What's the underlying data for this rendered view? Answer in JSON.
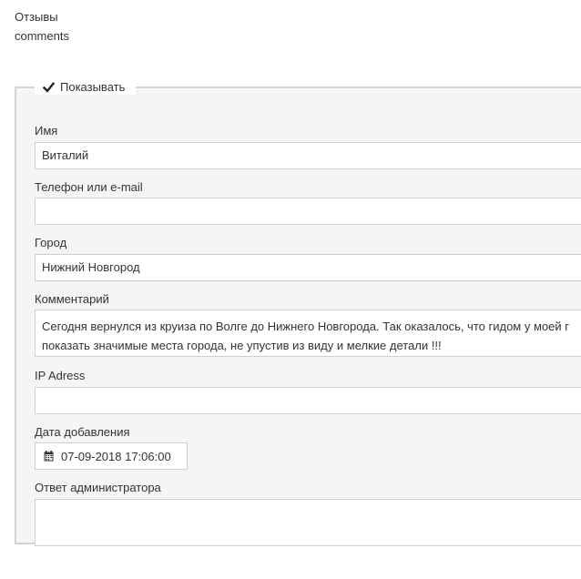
{
  "header": {
    "title_ru": "Отзывы",
    "title_en": "comments"
  },
  "record": {
    "show_label": "Показывать",
    "show_checked": true,
    "fields": {
      "name": {
        "label": "Имя",
        "value": "Виталий"
      },
      "contact": {
        "label": "Телефон или e-mail",
        "value": ""
      },
      "city": {
        "label": "Город",
        "value": "Нижний Новгород"
      },
      "comment": {
        "label": "Комментарий",
        "line1": "Сегодня вернулся из круиза по Волге до Нижнего Новгорода. Так оказалось, что гидом у моей г",
        "line2": "показать значимые места города, не упустив из виду и мелкие детали !!!"
      },
      "ip": {
        "label": "IP Adress",
        "value": ""
      },
      "date": {
        "label": "Дата добавления",
        "value": "07-09-2018 17:06:00"
      },
      "admin_reply": {
        "label": "Ответ администратора",
        "value": ""
      }
    }
  },
  "icons": {
    "checkbox": "check-mark",
    "date": "calendar-icon"
  }
}
